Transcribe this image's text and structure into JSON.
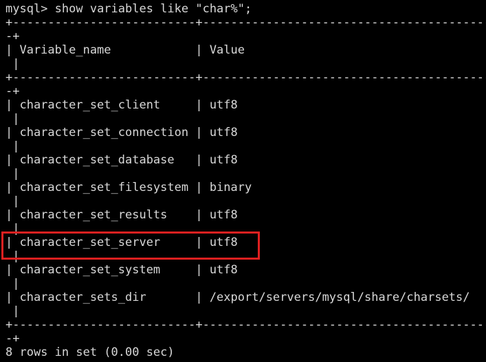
{
  "terminal": {
    "prompt": "mysql> ",
    "command": "show variables like \"char%\";",
    "border_top_a": "+--------------------------+------------------------------------------",
    "border_top_b": "-+",
    "header": {
      "col1": "| Variable_name            ",
      "col2": "| Value",
      "wrap": " |"
    },
    "border_mid_a": "+--------------------------+------------------------------------------",
    "border_mid_b": "-+",
    "rows": [
      {
        "name": "| character_set_client     ",
        "value": "| utf8",
        "wrap": " |"
      },
      {
        "name": "| character_set_connection ",
        "value": "| utf8",
        "wrap": " |"
      },
      {
        "name": "| character_set_database   ",
        "value": "| utf8",
        "wrap": " |"
      },
      {
        "name": "| character_set_filesystem ",
        "value": "| binary",
        "wrap": " |"
      },
      {
        "name": "| character_set_results    ",
        "value": "| utf8",
        "wrap": " |"
      },
      {
        "name": "| character_set_server     ",
        "value": "| utf8",
        "wrap": " |"
      },
      {
        "name": "| character_set_system     ",
        "value": "| utf8",
        "wrap": " |"
      },
      {
        "name": "| character_sets_dir       ",
        "value": "| /export/servers/mysql/share/charsets/",
        "wrap": " |"
      }
    ],
    "border_bot_a": "+--------------------------+------------------------------------------",
    "border_bot_b": "-+",
    "status": "8 rows in set (0.00 sec)"
  },
  "highlight_color": "#e02020"
}
